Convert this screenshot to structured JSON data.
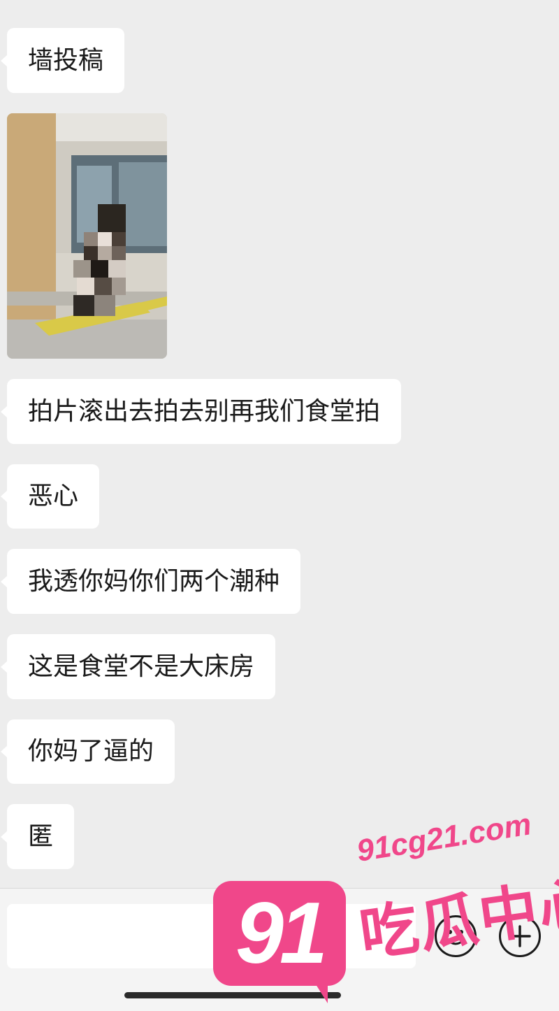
{
  "messages": [
    {
      "type": "text",
      "text": "墙投稿"
    },
    {
      "type": "image",
      "description": "pixelated photo of person in cafeteria"
    },
    {
      "type": "text",
      "text": "拍片滚出去拍去别再我们食堂拍"
    },
    {
      "type": "text",
      "text": "恶心"
    },
    {
      "type": "text",
      "text": "我透你妈你们两个潮种"
    },
    {
      "type": "text",
      "text": "这是食堂不是大床房"
    },
    {
      "type": "text",
      "text": "你妈了逼的"
    },
    {
      "type": "text",
      "text": "匿"
    }
  ],
  "input_bar": {
    "value": "",
    "icons": [
      "emoji-icon",
      "plus-icon"
    ]
  },
  "watermark": {
    "badge": "91",
    "url": "91cg21.com",
    "label": "吃瓜中心"
  },
  "colors": {
    "background": "#ededed",
    "bubble": "#ffffff",
    "watermark": "#f0478a"
  }
}
